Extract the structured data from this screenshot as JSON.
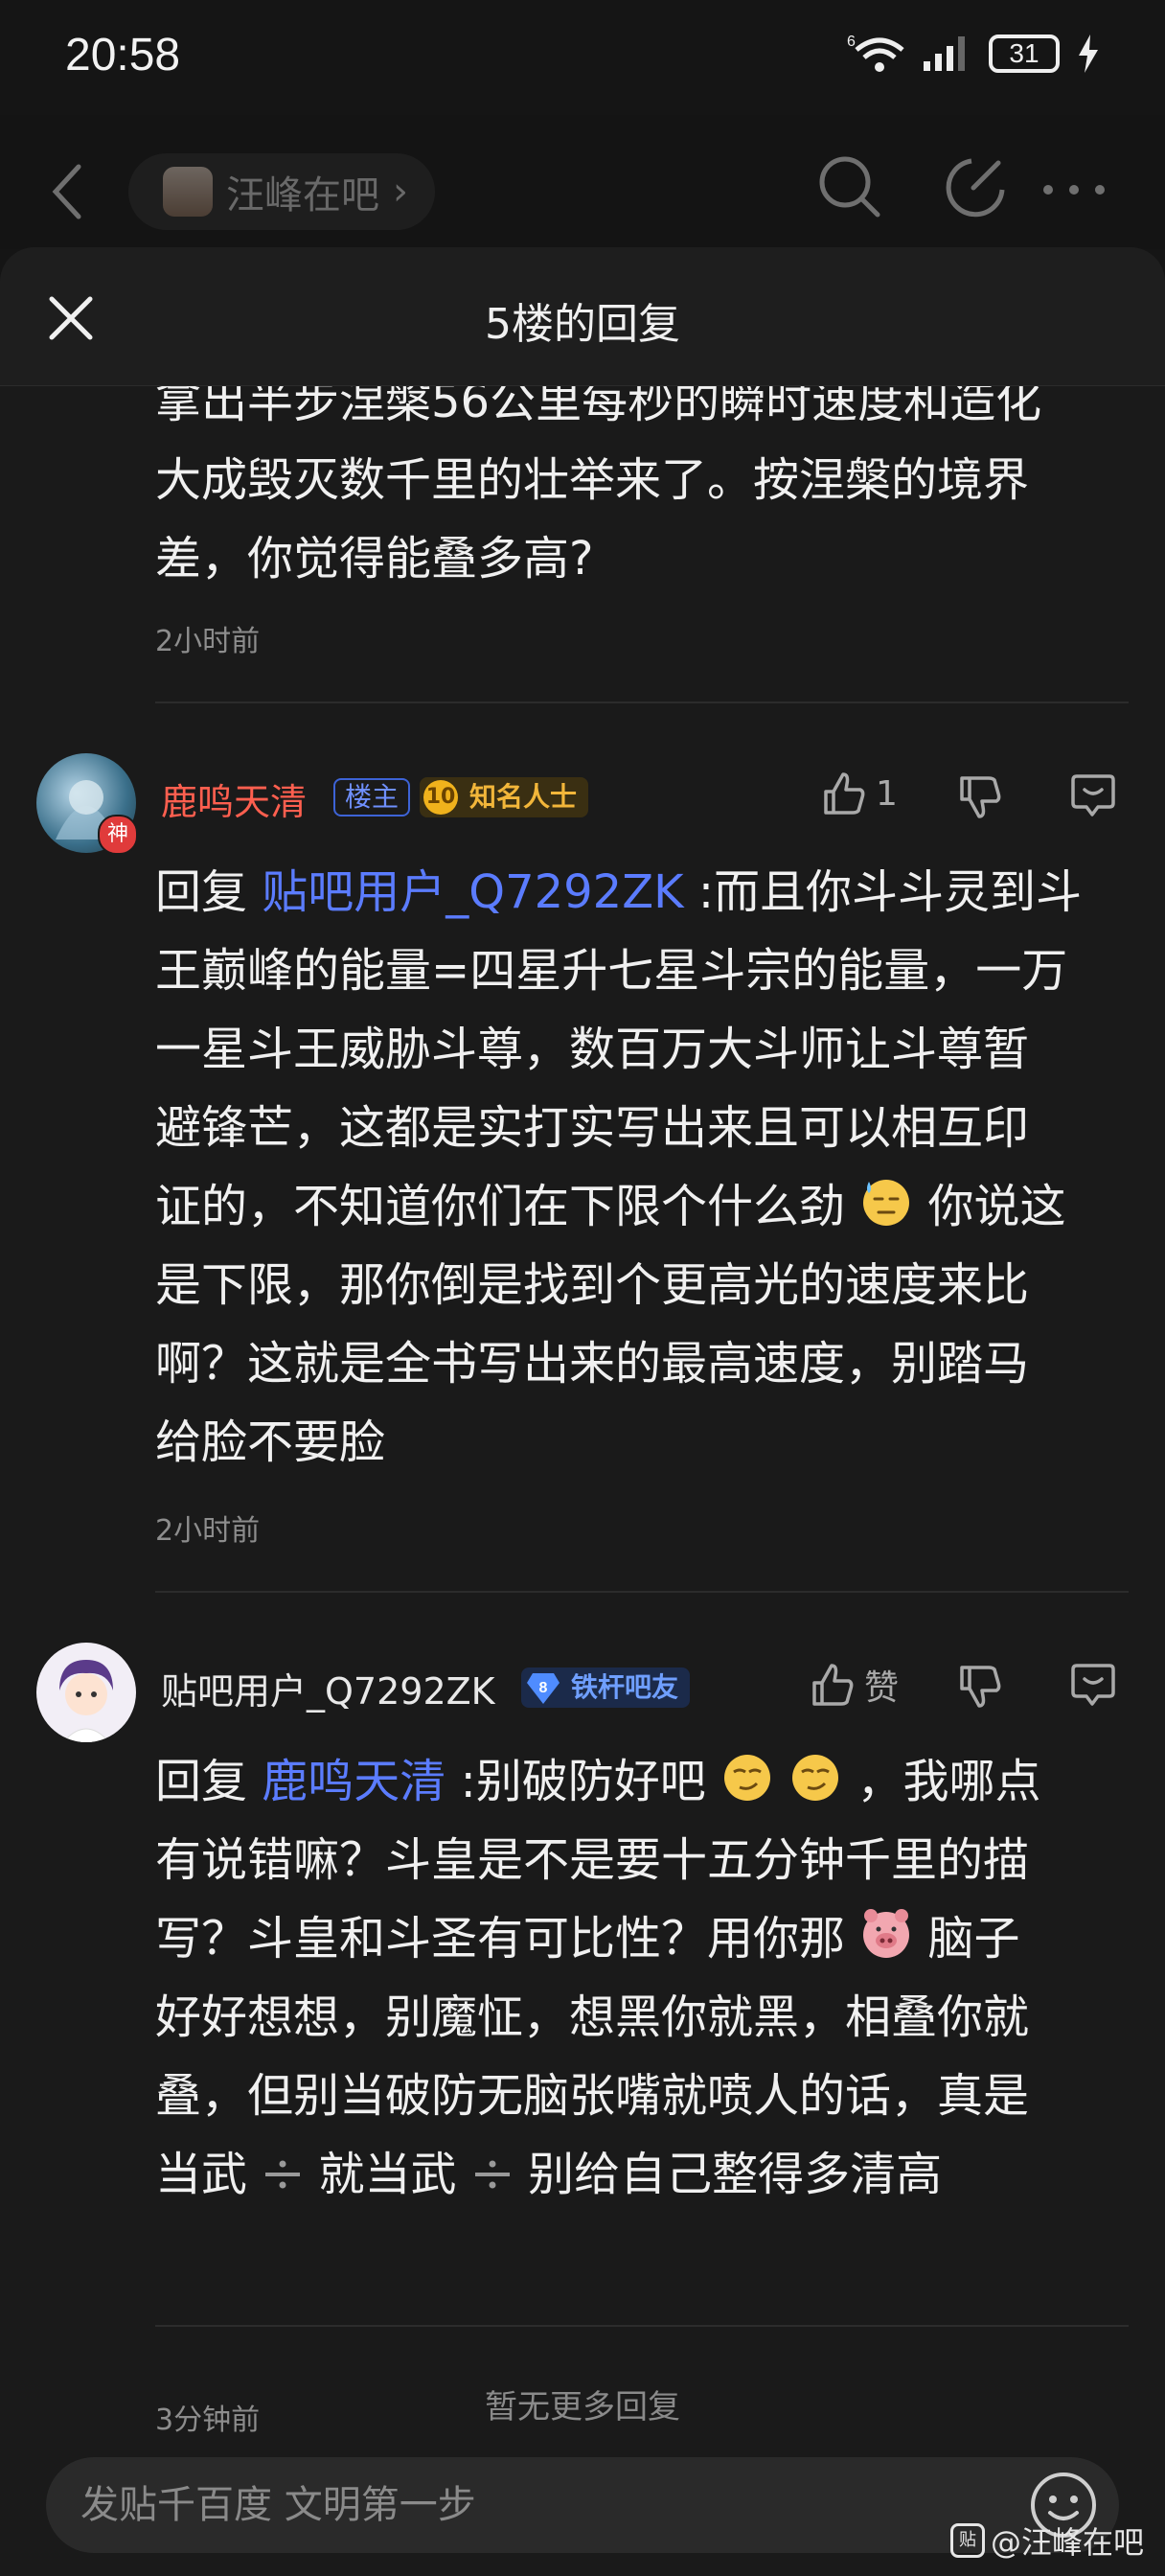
{
  "status_bar": {
    "time": "20:58",
    "network_label": "6",
    "battery": "31"
  },
  "top_nav": {
    "bar_name": "汪峰在吧",
    "bar_chevron": "›"
  },
  "sheet": {
    "title": "5楼的回复"
  },
  "main_post": {
    "lines": [
      "拿出半步涅槃56公里每秒的瞬时速度和造化",
      "大成毁灭数千里的壮举来了。按涅槃的境界",
      "差，你觉得能叠多高?"
    ],
    "time": "2小时前"
  },
  "replies": [
    {
      "username": "鹿鸣天清",
      "username_color": "#ff5f4f",
      "owner_badge": "楼主",
      "level": "10",
      "level_title": "知名人士",
      "avatar_badge": "神",
      "like_count": "1",
      "reply_prefix": "回复",
      "mention": "贴吧用户_Q7292ZK",
      "lines": [
        ":而且你斗斗灵到斗",
        "王巅峰的能量=四星升七星斗宗的能量，一万",
        "一星斗王威胁斗尊，数百万大斗师让斗尊暂",
        "避锋芒，这都是实打实写出来且可以相互印",
        "证的，不知道你们在下限个什么劲",
        " 你说这",
        "是下限，那你倒是找到个更高光的速度来比",
        "啊？这就是全书写出来的最高速度，别踏马",
        "给脸不要脸"
      ],
      "time": "2小时前"
    },
    {
      "username": "贴吧用户_Q7292ZK",
      "level": "8",
      "level_title": "铁杆吧友",
      "like_label": "赞",
      "reply_prefix": "回复",
      "mention": "鹿鸣天清",
      "lines": [
        ":别破防好吧",
        "，我哪点",
        "有说错嘛？斗皇是不是要十五分钟千里的描",
        "写？斗皇和斗圣有可比性？用你那",
        "脑子",
        "好好想想，别魔怔，想黑你就黑，相叠你就",
        "叠，但别当破防无脑张嘴就喷人的话，真是",
        "当武",
        "就当武",
        "别给自己整得多清高"
      ],
      "time": "3分钟前"
    }
  ],
  "footer": {
    "no_more": "暂无更多回复"
  },
  "composer": {
    "placeholder": "发贴千百度 文明第一步"
  },
  "watermark": {
    "logo": "贴",
    "text": "@汪峰在吧"
  },
  "colors": {
    "mention": "#5b7cff",
    "background": "#1a1a1a"
  }
}
